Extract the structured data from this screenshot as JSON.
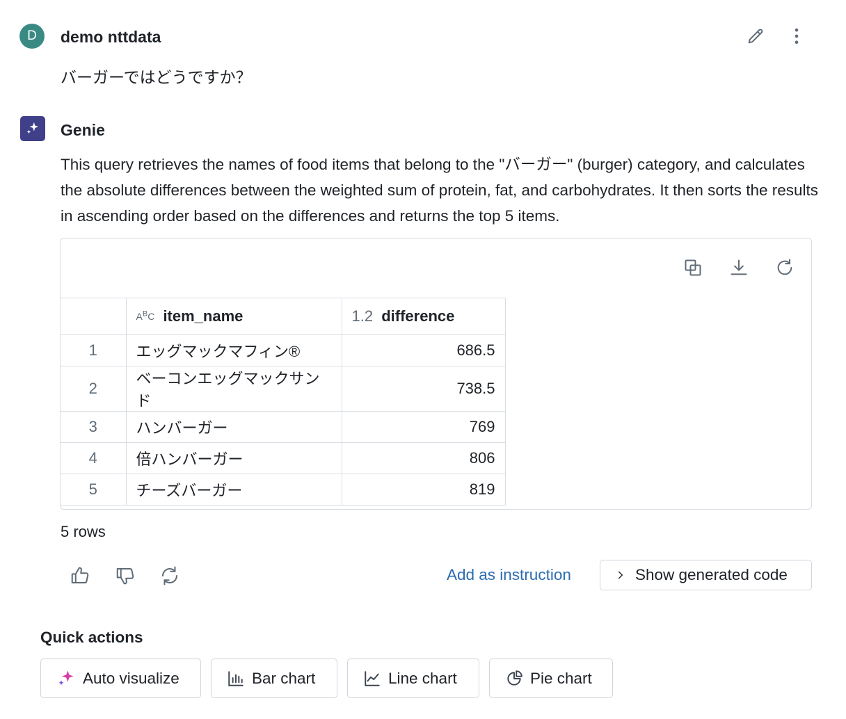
{
  "user_message": {
    "avatar_letter": "D",
    "author": "demo nttdata",
    "text": "バーガーではどうですか？",
    "edit_icon": "pencil-icon",
    "more_icon": "kebab-menu-icon"
  },
  "genie_message": {
    "author": "Genie",
    "avatar_icon": "sparkle-icon",
    "description": "This query retrieves the names of food items that belong to the \"バーガー\" (burger) category, and calculates the absolute differences between the weighted sum of protein, fat, and carbohydrates. It then sorts the results in ascending order based on the differences and returns the top 5 items."
  },
  "result_table": {
    "tools": [
      "copy-icon",
      "download-icon",
      "refresh-icon"
    ],
    "columns": [
      {
        "type_label": "ABC",
        "name": "item_name"
      },
      {
        "type_label": "1.2",
        "name": "difference"
      }
    ],
    "rows": [
      {
        "index": "1",
        "item_name": "エッグマックマフィン®",
        "difference": "686.5"
      },
      {
        "index": "2",
        "item_name": "ベーコンエッグマックサンド",
        "difference": "738.5"
      },
      {
        "index": "3",
        "item_name": "ハンバーガー",
        "difference": "769"
      },
      {
        "index": "4",
        "item_name": "倍ハンバーガー",
        "difference": "806"
      },
      {
        "index": "5",
        "item_name": "チーズバーガー",
        "difference": "819"
      }
    ],
    "row_count_label": "5 rows"
  },
  "actions": {
    "thumbs_up_icon": "thumbs-up-icon",
    "thumbs_down_icon": "thumbs-down-icon",
    "regenerate_icon": "regenerate-icon",
    "add_instruction": "Add as instruction",
    "show_code": "Show generated code"
  },
  "quick_actions": {
    "title": "Quick actions",
    "buttons": [
      {
        "label": "Auto visualize",
        "icon": "sparkle-icon"
      },
      {
        "label": "Bar chart",
        "icon": "bar-chart-icon"
      },
      {
        "label": "Line chart",
        "icon": "line-chart-icon"
      },
      {
        "label": "Pie chart",
        "icon": "pie-chart-icon"
      }
    ]
  },
  "colors": {
    "user_avatar": "#3a8a84",
    "genie_avatar": "#3f3f8a",
    "link": "#2b6cb0",
    "border": "#d8dde3"
  }
}
